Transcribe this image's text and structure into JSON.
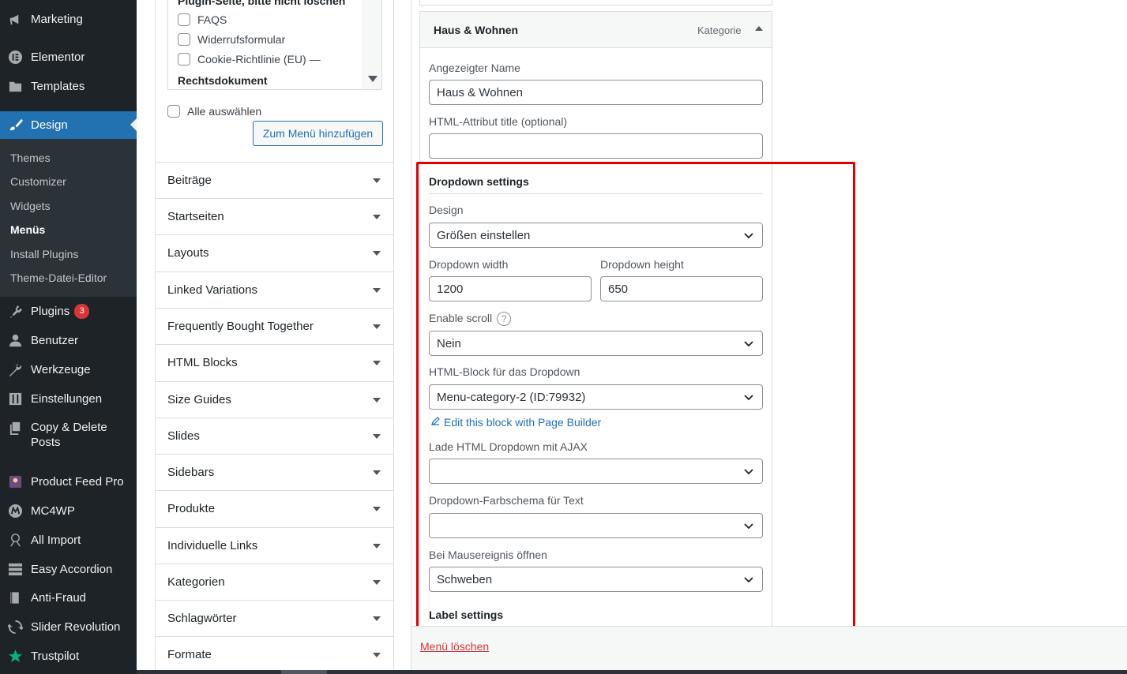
{
  "sidebar": {
    "items": [
      {
        "label": "Marketing",
        "icon": "megaphone-icon"
      },
      {
        "label": "Elementor",
        "icon": "elementor-icon"
      },
      {
        "label": "Templates",
        "icon": "folder-icon"
      },
      {
        "label": "Design",
        "icon": "paintbrush-icon"
      },
      {
        "label": "Plugins",
        "icon": "plugin-icon",
        "badge": "3"
      },
      {
        "label": "Benutzer",
        "icon": "user-icon"
      },
      {
        "label": "Werkzeuge",
        "icon": "wrench-icon"
      },
      {
        "label": "Einstellungen",
        "icon": "settings-sliders-icon"
      },
      {
        "label_line1": "Copy & Delete",
        "label_line2": "Posts",
        "icon": "copy-icon"
      },
      {
        "label": "Product Feed Pro",
        "icon": "product-feed-icon"
      },
      {
        "label": "MC4WP",
        "icon": "mc4wp-icon"
      },
      {
        "label": "All Import",
        "icon": "all-import-icon"
      },
      {
        "label": "Easy Accordion",
        "icon": "accordion-icon"
      },
      {
        "label": "Anti-Fraud",
        "icon": "book-icon"
      },
      {
        "label": "Slider Revolution",
        "icon": "refresh-icon"
      },
      {
        "label": "Trustpilot",
        "icon": "star-icon"
      }
    ],
    "submenu": [
      "Themes",
      "Customizer",
      "Widgets",
      "Menüs",
      "Install Plugins",
      "Theme-Datei-Editor"
    ]
  },
  "pagebox": {
    "partial_top": "Plugin-Seite, bitte nicht löschen",
    "items": [
      "FAQS",
      "Widerrufsformular",
      "Cookie-Richtlinie (EU) —"
    ],
    "partial_bottom": "Rechtsdokument",
    "select_all": "Alle auswählen",
    "add_button": "Zum Menü hinzufügen"
  },
  "accordions": [
    "Beiträge",
    "Startseiten",
    "Layouts",
    "Linked Variations",
    "Frequently Bought Together",
    "HTML Blocks",
    "Size Guides",
    "Slides",
    "Sidebars",
    "Produkte",
    "Individuelle Links",
    "Kategorien",
    "Schlagwörter",
    "Formate"
  ],
  "menu_item": {
    "title": "Haus & Wohnen",
    "type": "Kategorie",
    "nav_label_caption": "Angezeigter Name",
    "nav_label_value": "Haus & Wohnen",
    "title_attr_caption": "HTML-Attribut title (optional)",
    "title_attr_value": ""
  },
  "dropdown_settings": {
    "heading": "Dropdown settings",
    "design_label": "Design",
    "design_value": "Größen einstellen",
    "width_label": "Dropdown width",
    "width_value": "1200",
    "height_label": "Dropdown height",
    "height_value": "650",
    "scroll_label": "Enable scroll",
    "scroll_help": "?",
    "scroll_value": "Nein",
    "html_block_label": "HTML-Block für das Dropdown",
    "html_block_value": "Menu-category-2 (ID:79932)",
    "edit_link": "Edit this block with Page Builder",
    "ajax_label": "Lade HTML Dropdown mit AJAX",
    "ajax_value": "",
    "color_label": "Dropdown-Farbschema für Text",
    "color_value": "",
    "event_label": "Bei Mausereignis öffnen",
    "event_value": "Schweben"
  },
  "label_settings": {
    "heading": "Label settings"
  },
  "footer": {
    "delete_menu": "Menü löschen"
  },
  "colors": {
    "accent": "#2271b1",
    "highlight": "#e00000",
    "sidebar_bg": "#1d2327",
    "danger": "#d63638"
  }
}
